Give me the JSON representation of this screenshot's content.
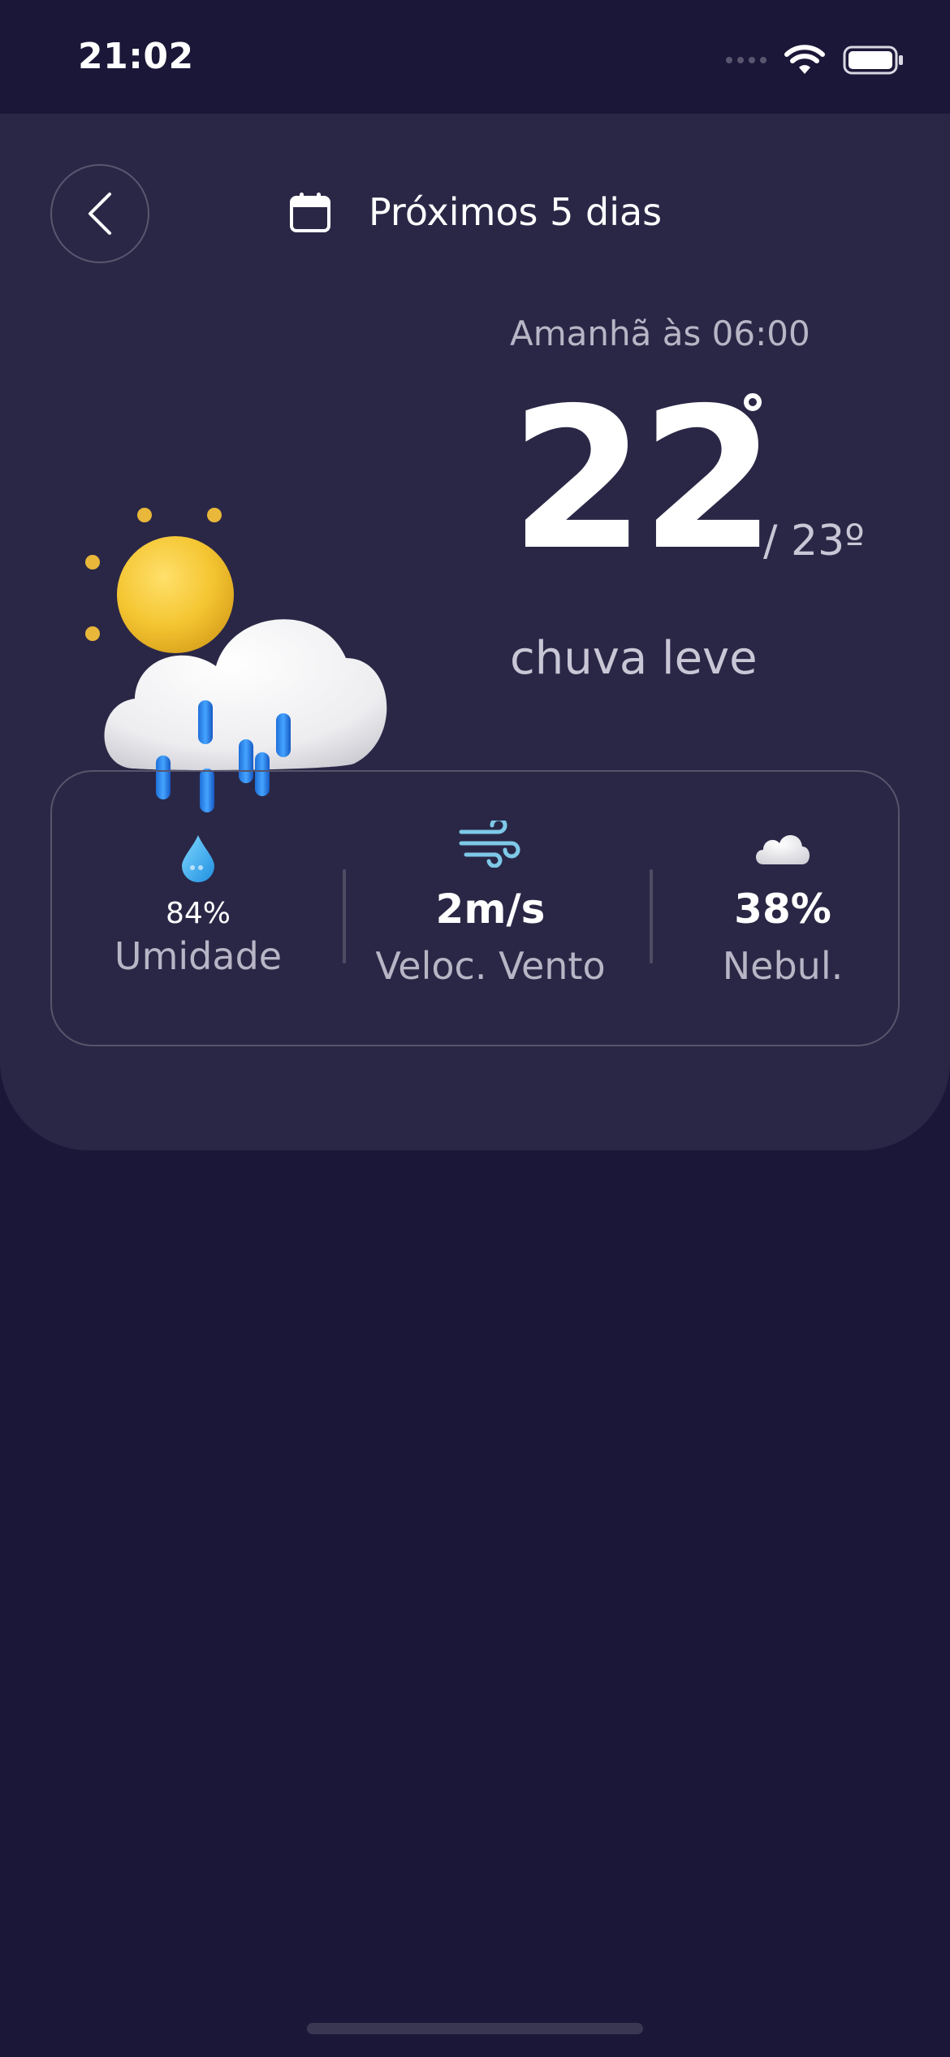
{
  "status_bar": {
    "time": "21:02",
    "icons": [
      "signal-dots-icon",
      "wifi-icon",
      "battery-icon"
    ]
  },
  "header": {
    "back_icon": "chevron-left-icon",
    "calendar_icon": "calendar-icon",
    "title": "Próximos 5 dias"
  },
  "forecast": {
    "time_label": "Amanhã às 06:00",
    "temperature": "22",
    "max_temperature": "/ 23º",
    "condition": "chuva leve",
    "illustration": "sun-cloud-rain-icon"
  },
  "stats": {
    "humidity": {
      "value": "84%",
      "label": "Umidade",
      "icon": "water-drop-icon"
    },
    "wind": {
      "value": "2m/s",
      "label": "Veloc. Vento",
      "icon": "wind-icon"
    },
    "cloudiness": {
      "value": "38%",
      "label": "Nebul.",
      "icon": "cloud-icon"
    }
  },
  "colors": {
    "background": "#1b1738",
    "card": "#2a2746",
    "text_primary": "#ffffff",
    "text_secondary": "#b8b5c6"
  }
}
